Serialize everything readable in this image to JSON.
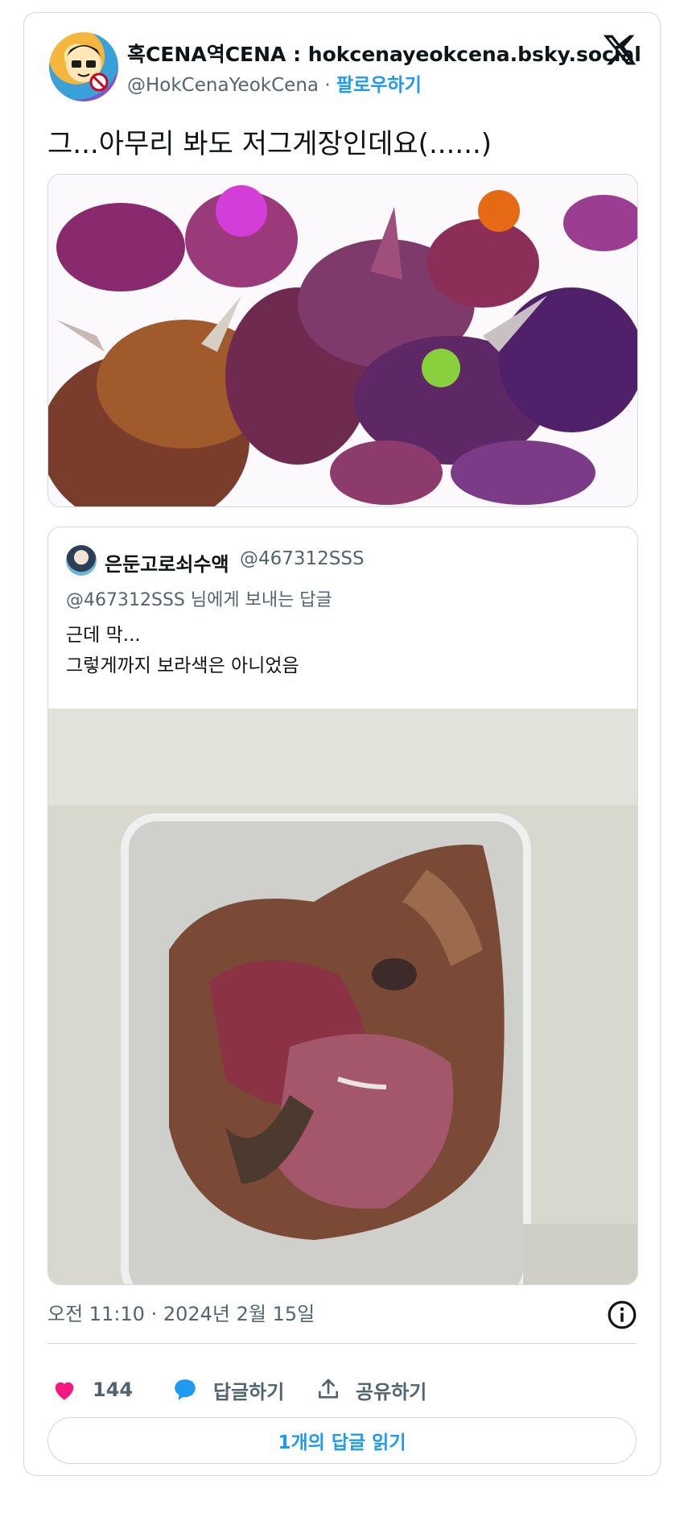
{
  "author": {
    "name": "혹CENA역CENA : hokcenayeokcena.bsky.social",
    "handle": "@HokCenaYeokCena",
    "separator": "·",
    "follow_label": "팔로우하기"
  },
  "tweet": {
    "text": "그...아무리 봐도 저그게장인데요(......)"
  },
  "quote": {
    "name": "은둔고로쇠수액",
    "handle": "@467312SSS",
    "reply_to": "@467312SSS 님에게 보내는 답글",
    "lines": [
      "근데 막...",
      "그렇게까지 보라색은 아니었음"
    ]
  },
  "meta": {
    "timestamp": "오전 11:10 · 2024년 2월 15일"
  },
  "actions": {
    "like_count": "144",
    "reply_label": "답글하기",
    "share_label": "공유하기",
    "read_replies_label": "1개의 답글 읽기"
  },
  "icons": {
    "brand": "x-logo-icon",
    "like": "heart-icon",
    "reply": "speech-bubble-icon",
    "share": "share-upload-icon",
    "info": "info-icon"
  },
  "colors": {
    "accent": "#1d9bf0",
    "like": "#f91880",
    "muted": "#536471"
  }
}
